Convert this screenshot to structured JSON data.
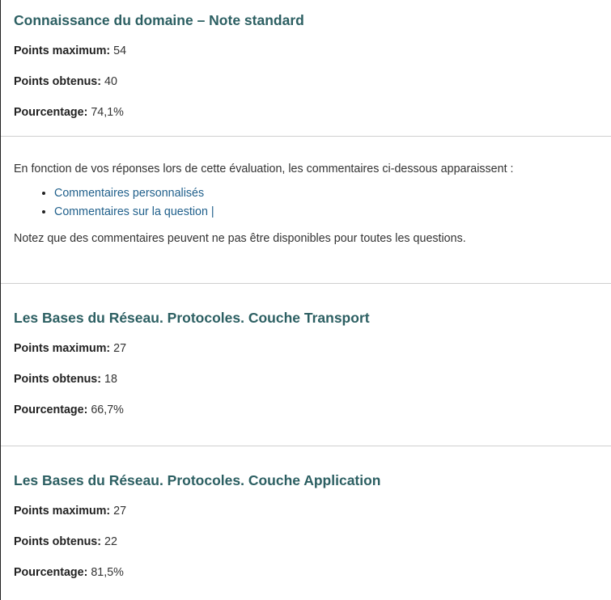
{
  "sections": [
    {
      "title": "Connaissance du domaine – Note standard",
      "max_label": "Points maximum:",
      "max_value": "54",
      "obtained_label": "Points obtenus:",
      "obtained_value": "40",
      "percent_label": "Pourcentage:",
      "percent_value": "74,1%"
    },
    {
      "title": "Les Bases du Réseau. Protocoles. Couche Transport",
      "max_label": "Points maximum:",
      "max_value": "27",
      "obtained_label": "Points obtenus:",
      "obtained_value": "18",
      "percent_label": "Pourcentage:",
      "percent_value": "66,7%"
    },
    {
      "title": "Les Bases du Réseau. Protocoles. Couche Application",
      "max_label": "Points maximum:",
      "max_value": "27",
      "obtained_label": "Points obtenus:",
      "obtained_value": "22",
      "percent_label": "Pourcentage:",
      "percent_value": "81,5%"
    }
  ],
  "feedback": {
    "intro": "En fonction de vos réponses lors de cette évaluation, les commentaires ci-dessous apparaissent :",
    "links": [
      "Commentaires personnalisés",
      "Commentaires sur la question |"
    ],
    "note": "Notez que des commentaires peuvent ne pas être disponibles pour toutes les questions."
  },
  "colors": {
    "heading": "#2c5f62",
    "link": "#1f5f8b",
    "divider": "#cfcfcf"
  }
}
